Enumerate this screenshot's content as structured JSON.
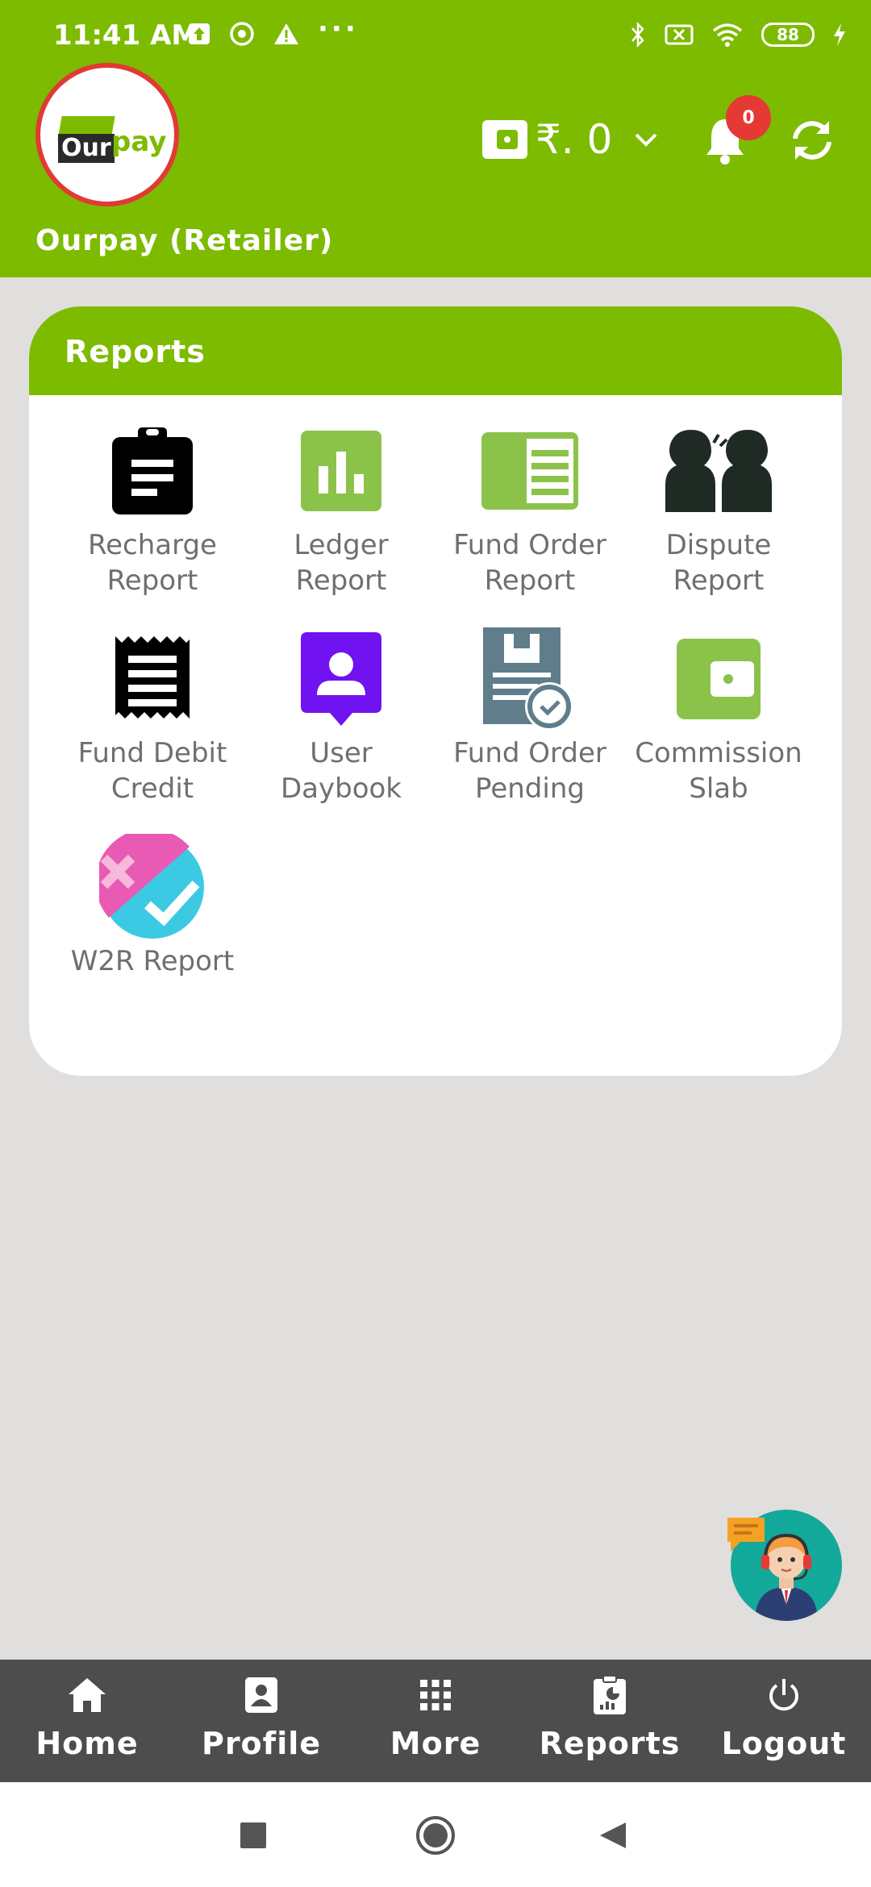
{
  "status_bar": {
    "time": "11:41 AM",
    "dots": "···",
    "battery": "88"
  },
  "header": {
    "logo_our": "Our",
    "logo_pay": "pay",
    "wallet_amount": "₹. 0",
    "notification_count": "0",
    "account_name": "Ourpay (Retailer)"
  },
  "reports_card": {
    "title": "Reports",
    "items": [
      {
        "label": "Recharge\nReport",
        "icon": "clipboard-icon"
      },
      {
        "label": "Ledger\nReport",
        "icon": "bar-chart-icon"
      },
      {
        "label": "Fund Order\nReport",
        "icon": "document-panel-icon"
      },
      {
        "label": "Dispute\nReport",
        "icon": "dispute-people-icon"
      },
      {
        "label": "Fund Debit\nCredit",
        "icon": "receipt-icon"
      },
      {
        "label": "User\nDaybook",
        "icon": "user-badge-icon"
      },
      {
        "label": "Fund Order\nPending",
        "icon": "pending-document-icon"
      },
      {
        "label": "Commission\nSlab",
        "icon": "wallet-icon"
      },
      {
        "label": "W2R Report",
        "icon": "cross-check-icon"
      }
    ]
  },
  "bottom_nav": [
    {
      "label": "Home",
      "icon": "home-icon"
    },
    {
      "label": "Profile",
      "icon": "profile-icon"
    },
    {
      "label": "More",
      "icon": "grid-icon"
    },
    {
      "label": "Reports",
      "icon": "report-icon"
    },
    {
      "label": "Logout",
      "icon": "power-icon"
    }
  ],
  "colors": {
    "brand_green": "#7dbb00",
    "background": "#e0dfde",
    "nav_bg": "#4d4d4d",
    "badge_red": "#e53935",
    "label_grey": "#6f6f6f"
  }
}
